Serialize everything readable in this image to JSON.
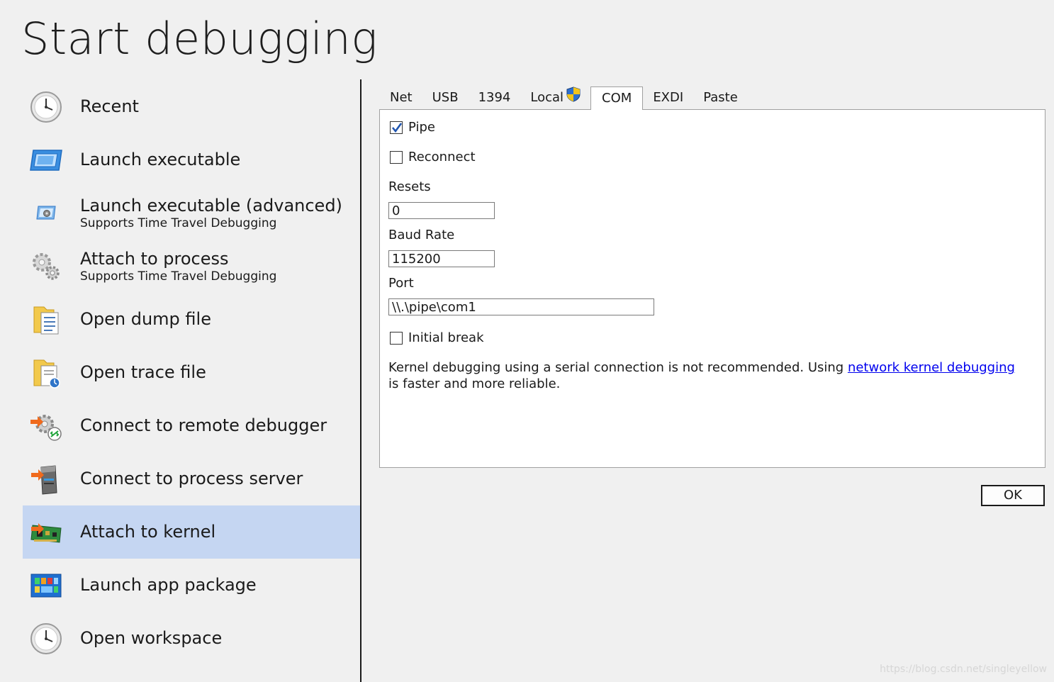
{
  "page": {
    "title": "Start debugging"
  },
  "sidebar": {
    "items": [
      {
        "label": "Recent",
        "icon": "clock-icon"
      },
      {
        "label": "Launch executable",
        "icon": "window-icon"
      },
      {
        "label": "Launch executable (advanced)",
        "sublabel": "Supports Time Travel Debugging",
        "icon": "window-gear-icon"
      },
      {
        "label": "Attach to process",
        "sublabel": "Supports Time Travel Debugging",
        "icon": "gears-icon"
      },
      {
        "label": "Open dump file",
        "icon": "folder-document-icon"
      },
      {
        "label": "Open trace file",
        "icon": "folder-trace-icon"
      },
      {
        "label": "Connect to remote debugger",
        "icon": "remote-debugger-icon"
      },
      {
        "label": "Connect to process server",
        "icon": "server-icon"
      },
      {
        "label": "Attach to kernel",
        "icon": "circuit-board-icon",
        "selected": true
      },
      {
        "label": "Launch app package",
        "icon": "app-package-icon"
      },
      {
        "label": "Open workspace",
        "icon": "clock-icon"
      }
    ]
  },
  "tabs": [
    {
      "label": "Net"
    },
    {
      "label": "USB"
    },
    {
      "label": "1394"
    },
    {
      "label": "Local",
      "icon": "uac-shield-icon"
    },
    {
      "label": "COM",
      "active": true
    },
    {
      "label": "EXDI"
    },
    {
      "label": "Paste"
    }
  ],
  "com": {
    "pipe": {
      "label": "Pipe",
      "checked": true
    },
    "reconnect": {
      "label": "Reconnect",
      "checked": false
    },
    "resets": {
      "label": "Resets",
      "value": "0"
    },
    "baud_rate": {
      "label": "Baud Rate",
      "value": "115200"
    },
    "port": {
      "label": "Port",
      "value": "\\\\.\\pipe\\com1"
    },
    "initial_break": {
      "label": "Initial break",
      "checked": false
    },
    "note": {
      "before": "Kernel debugging using a serial connection is not recommended. Using ",
      "link": "network kernel debugging",
      "after": " is faster and more reliable."
    }
  },
  "ok_label": "OK",
  "watermark": "https://blog.csdn.net/singleyellow",
  "colors": {
    "background": "#f0f0f0",
    "selected_item": "#c5d6f2",
    "link": "#0000ee",
    "panel": "#ffffff"
  }
}
